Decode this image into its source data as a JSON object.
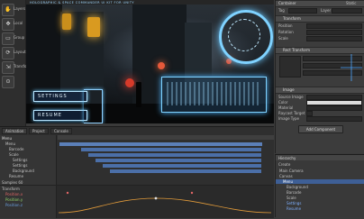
{
  "tools": [
    {
      "icon": "hand-icon",
      "glyph": "✋",
      "label": "Layers"
    },
    {
      "icon": "move-icon",
      "glyph": "✥",
      "label": "Local"
    },
    {
      "icon": "rect-icon",
      "glyph": "▭",
      "label": "Group"
    },
    {
      "icon": "rotate-icon",
      "glyph": "⟳",
      "label": "Layout"
    },
    {
      "icon": "scale-icon",
      "glyph": "⇲",
      "label": "Transform"
    },
    {
      "icon": "pivot-icon",
      "glyph": "⊙",
      "label": ""
    }
  ],
  "viewport": {
    "overlay_text": "HOLOGRAPHIC & SPACE COMMANDER UI KIT FOR UNITY",
    "buttons": [
      "SETTINGS",
      "RESUME"
    ]
  },
  "inspector": {
    "object_name": "Container",
    "static_label": "Static",
    "tag_label": "Tag",
    "layer_label": "Layer",
    "sections": [
      "Transform",
      "Rect Transform",
      "Image"
    ],
    "field_labels": [
      "Position",
      "Rotation",
      "Scale",
      "Source Image",
      "Color",
      "Material",
      "Raycast Target",
      "Image Type"
    ],
    "add_component": "Add Component"
  },
  "animation": {
    "tabs": [
      "Animation",
      "Project",
      "Console"
    ],
    "clip_name": "Menu",
    "rows": [
      "Menu",
      "Barcode",
      "Scale",
      "Settings",
      "Settings",
      "Background",
      "Resume"
    ],
    "sample_label": "Samples 60",
    "curve_rows": [
      "Transform",
      "Position.x",
      "Position.y",
      "Position.z"
    ]
  },
  "hierarchy": {
    "title": "Hierarchy",
    "create_label": "Create",
    "items": [
      "Main Camera",
      "Canvas",
      "Menu",
      "Background",
      "Barcode",
      "Scale",
      "Settings",
      "Resume"
    ]
  }
}
